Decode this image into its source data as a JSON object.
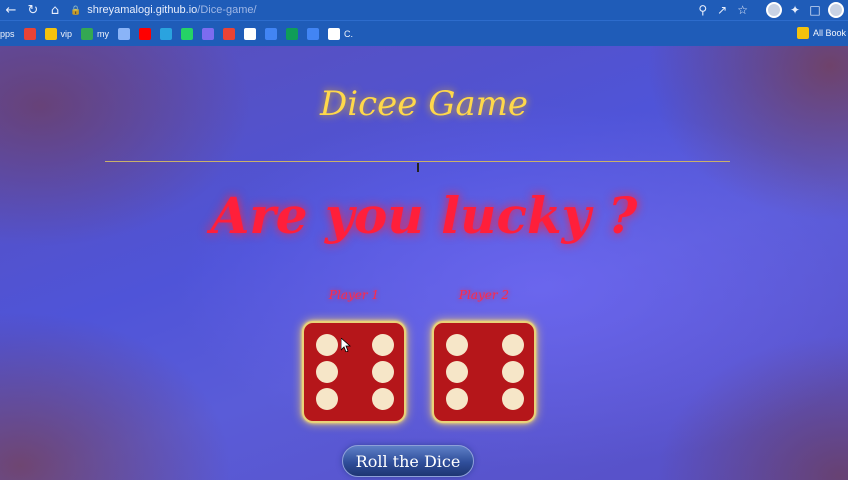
{
  "browser": {
    "url_host": "shreyamalogi.github.io",
    "url_path": "/Dice-game/",
    "bookmarks": [
      {
        "label": "pps",
        "color": ""
      },
      {
        "label": "",
        "color": "#ea4335"
      },
      {
        "label": "vip",
        "color": "#f4c20d"
      },
      {
        "label": "my",
        "color": "#34a853"
      },
      {
        "label": "",
        "color": "#8ab4f8"
      },
      {
        "label": "",
        "color": "#ff0000"
      },
      {
        "label": "",
        "color": "#2aa3df"
      },
      {
        "label": "",
        "color": "#25d366"
      },
      {
        "label": "",
        "color": "#7c6cf0"
      },
      {
        "label": "",
        "color": "#ea4335"
      },
      {
        "label": "",
        "color": "#ffffff"
      },
      {
        "label": "",
        "color": "#4285f4"
      },
      {
        "label": "",
        "color": "#0f9d58"
      },
      {
        "label": "",
        "color": "#4285f4"
      },
      {
        "label": "C.",
        "color": "#ffffff"
      }
    ],
    "all_bookmarks_label": "All Book"
  },
  "game": {
    "title": "Dicee Game",
    "tagline": "Are you lucky ?",
    "player1_label": "Player 1",
    "player2_label": "Player 2",
    "die1_value": 6,
    "die2_value": 6,
    "roll_button_label": "Roll the Dice"
  },
  "colors": {
    "title": "#ffd84a",
    "tagline": "#ff1f3a",
    "die_face": "#b5161a",
    "pip": "#f6e6c8",
    "die_glow": "#e8d27a"
  }
}
